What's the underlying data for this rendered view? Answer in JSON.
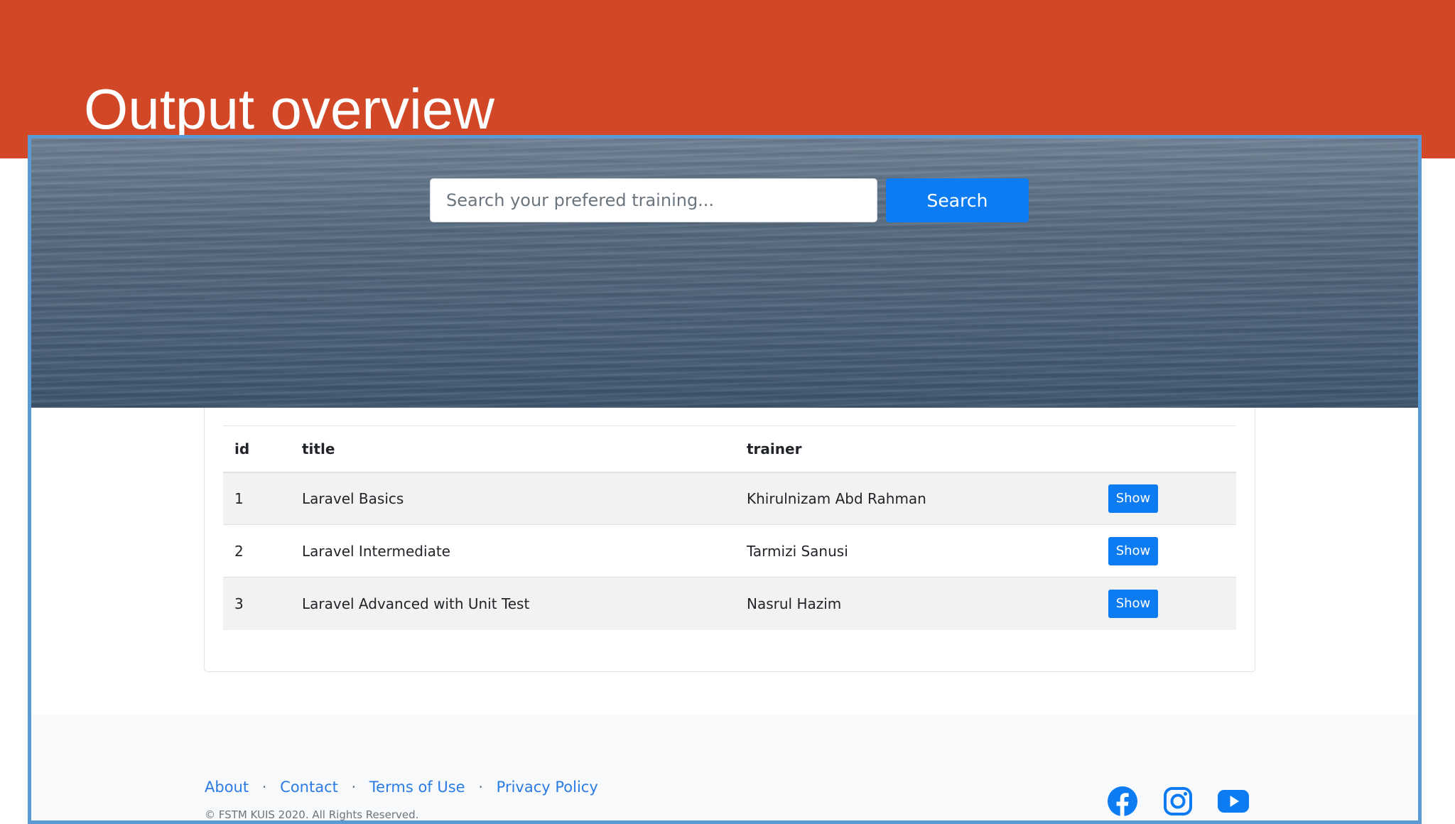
{
  "slide": {
    "title": "Output overview"
  },
  "search": {
    "placeholder": "Search your prefered training...",
    "value": "",
    "button_label": "Search"
  },
  "table": {
    "headers": {
      "id": "id",
      "title": "title",
      "trainer": "trainer"
    },
    "rows": [
      {
        "id": "1",
        "title": "Laravel Basics",
        "trainer": "Khirulnizam Abd Rahman",
        "action": "Show"
      },
      {
        "id": "2",
        "title": "Laravel Intermediate",
        "trainer": "Tarmizi Sanusi",
        "action": "Show"
      },
      {
        "id": "3",
        "title": "Laravel Advanced with Unit Test",
        "trainer": "Nasrul Hazim",
        "action": "Show"
      }
    ]
  },
  "footer": {
    "links": [
      "About",
      "Contact",
      "Terms of Use",
      "Privacy Policy"
    ],
    "separator": "·",
    "copyright": "© FSTM KUIS 2020. All Rights Reserved.",
    "social": [
      "facebook-icon",
      "instagram-icon",
      "youtube-icon"
    ]
  },
  "colors": {
    "banner": "#d24726",
    "frame_border": "#5b9bd5",
    "primary_button": "#0d7cf2",
    "link": "#2a7be4"
  }
}
